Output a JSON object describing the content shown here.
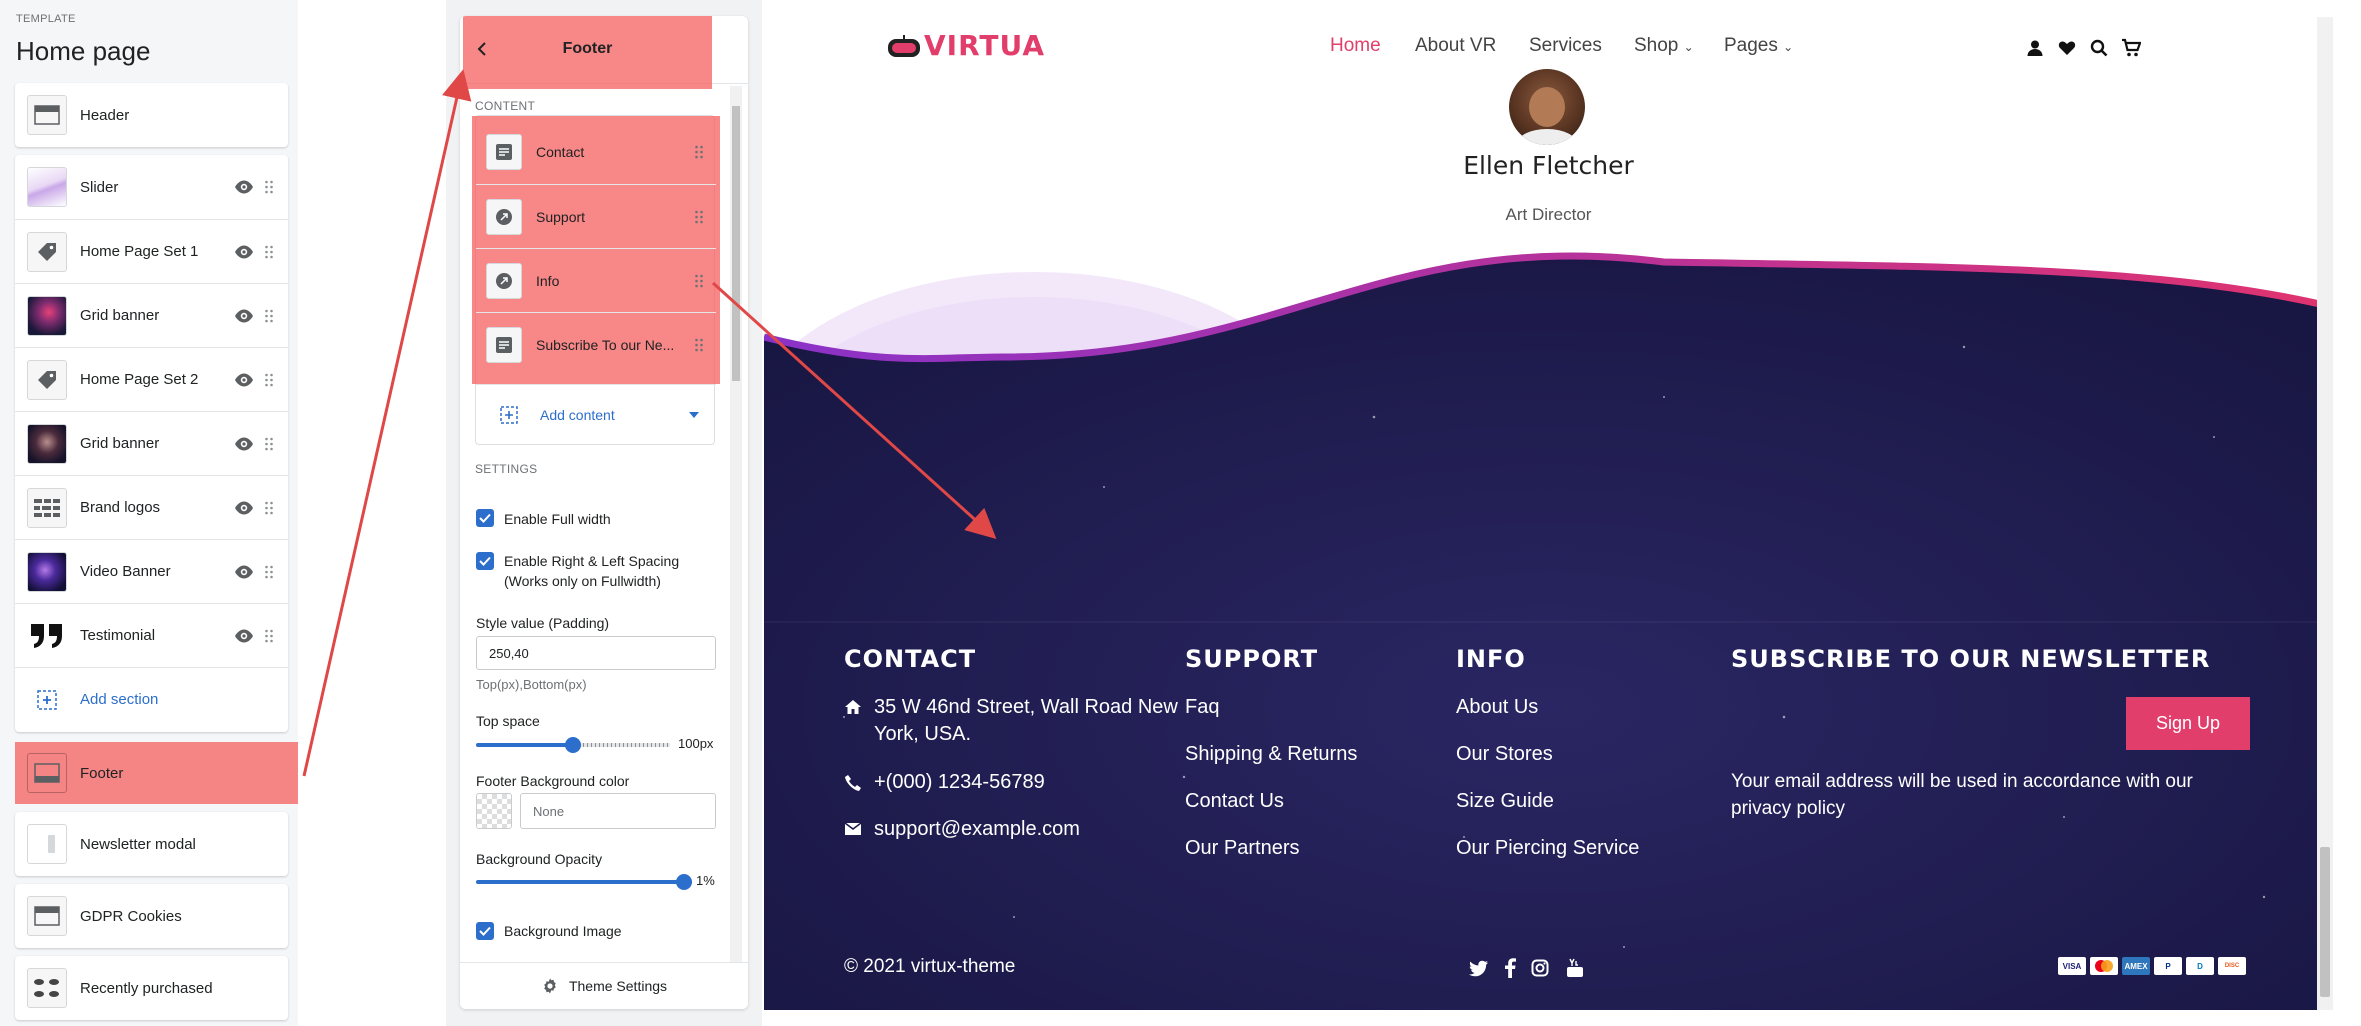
{
  "left_panel": {
    "template_label": "TEMPLATE",
    "title": "Home page",
    "header_label": "Header",
    "sections": [
      {
        "label": "Slider"
      },
      {
        "label": "Home Page Set 1"
      },
      {
        "label": "Grid banner"
      },
      {
        "label": "Home Page Set 2"
      },
      {
        "label": "Grid banner"
      },
      {
        "label": "Brand logos"
      },
      {
        "label": "Video Banner"
      },
      {
        "label": "Testimonial"
      }
    ],
    "add_section": "Add section",
    "footer_label": "Footer",
    "newsletter_label": "Newsletter modal",
    "gdpr_label": "GDPR Cookies",
    "recent_label": "Recently purchased"
  },
  "editor": {
    "title": "Footer",
    "content_label": "CONTENT",
    "blocks": [
      {
        "label": "Contact",
        "icon": "text-block-icon"
      },
      {
        "label": "Support",
        "icon": "link-list-icon"
      },
      {
        "label": "Info",
        "icon": "link-list-icon"
      },
      {
        "label": "Subscribe To our Ne...",
        "icon": "text-block-icon"
      }
    ],
    "add_content": "Add content",
    "settings_label": "SETTINGS",
    "full_width": "Enable Full width",
    "spacing_line1": "Enable Right & Left Spacing",
    "spacing_line2": "(Works only on Fullwidth)",
    "style_label": "Style value (Padding)",
    "style_value": "250,40",
    "style_hint": "Top(px),Bottom(px)",
    "top_space_label": "Top space",
    "top_space_value": "100px",
    "top_space_fraction": 0.5,
    "bg_color_label": "Footer Background color",
    "bg_color_value": "None",
    "opacity_label": "Background Opacity",
    "opacity_value": "1%",
    "bg_image_label": "Background Image",
    "theme_settings": "Theme Settings"
  },
  "preview": {
    "brand": "VIRTUA",
    "nav": [
      {
        "label": "Home",
        "active": true
      },
      {
        "label": "About VR"
      },
      {
        "label": "Services"
      },
      {
        "label": "Shop",
        "dropdown": true
      },
      {
        "label": "Pages",
        "dropdown": true
      }
    ],
    "testimonial_name": "Ellen Fletcher",
    "testimonial_role": "Art Director",
    "footer": {
      "contact_title": "CONTACT",
      "address_line1": "35 W 46nd Street, Wall Road New",
      "address_line2": "York, USA.",
      "phone": "+(000) 1234-56789",
      "email": "support@example.com",
      "support_title": "SUPPORT",
      "support_links": [
        "Faq",
        "Shipping & Returns",
        "Contact Us",
        "Our Partners"
      ],
      "info_title": "INFO",
      "info_links": [
        "About Us",
        "Our Stores",
        "Size Guide",
        "Our Piercing Service"
      ],
      "newsletter_title": "SUBSCRIBE TO OUR NEWSLETTER",
      "signup": "Sign Up",
      "newsletter_note_line1": "Your email address will be used in accordance with our",
      "newsletter_note_line2": "privacy policy",
      "copyright": "© 2021 virtux-theme",
      "payments": [
        "VISA",
        "MC",
        "AMEX",
        "PayPal",
        "Diners",
        "Discover"
      ]
    }
  },
  "colors": {
    "accent": "#e23e6b",
    "link_blue": "#2c6ecb",
    "footer_bg": "#1c1a48",
    "highlight": "#f56767"
  }
}
